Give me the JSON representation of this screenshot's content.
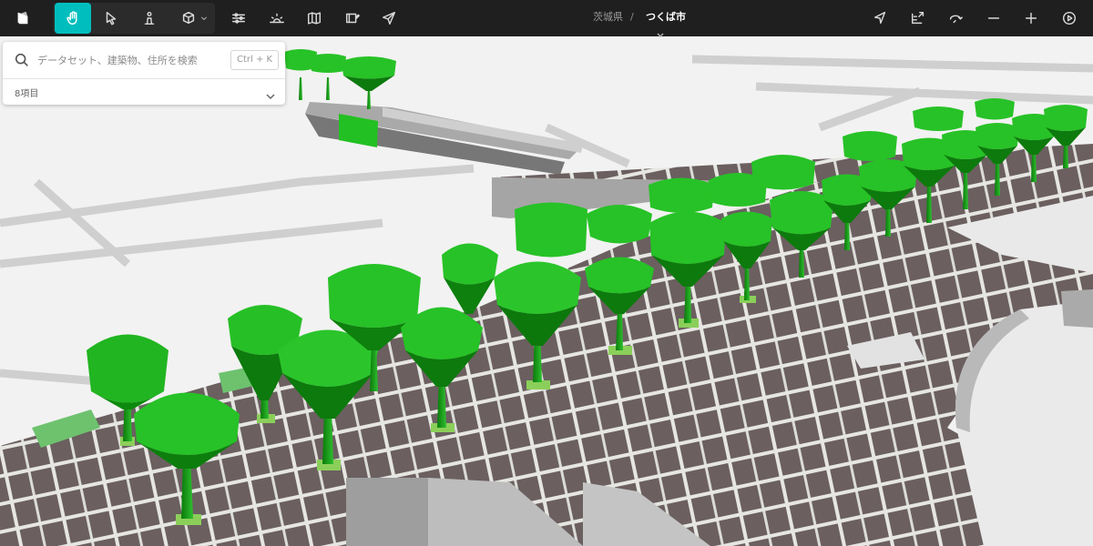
{
  "toolbar": {
    "tools": [
      {
        "name": "hand-icon",
        "active": true
      },
      {
        "name": "pointer-icon",
        "active": false
      },
      {
        "name": "pedestrian-icon",
        "active": false
      },
      {
        "name": "cube-icon",
        "active": false
      }
    ],
    "left_icons": [
      "sliders-icon",
      "sun-horizon-icon",
      "map-icon",
      "layers-edit-icon",
      "send-icon"
    ],
    "right_icons": [
      "location-arrow-icon",
      "export-icon",
      "rotate-icon",
      "zoom-out-icon",
      "zoom-in-icon",
      "play-icon"
    ]
  },
  "breadcrumb": {
    "prefecture": "茨城県",
    "separator": "/",
    "city": "つくば市"
  },
  "search": {
    "placeholder": "データセット、建築物、住所を検索",
    "shortcut": "Ctrl + K",
    "result_count": "8項目"
  },
  "colors": {
    "accent": "#00bebe",
    "toolbar_bg": "#1f1f1f",
    "tree_green": "#1fb41f",
    "pavement": "#6e6262"
  }
}
